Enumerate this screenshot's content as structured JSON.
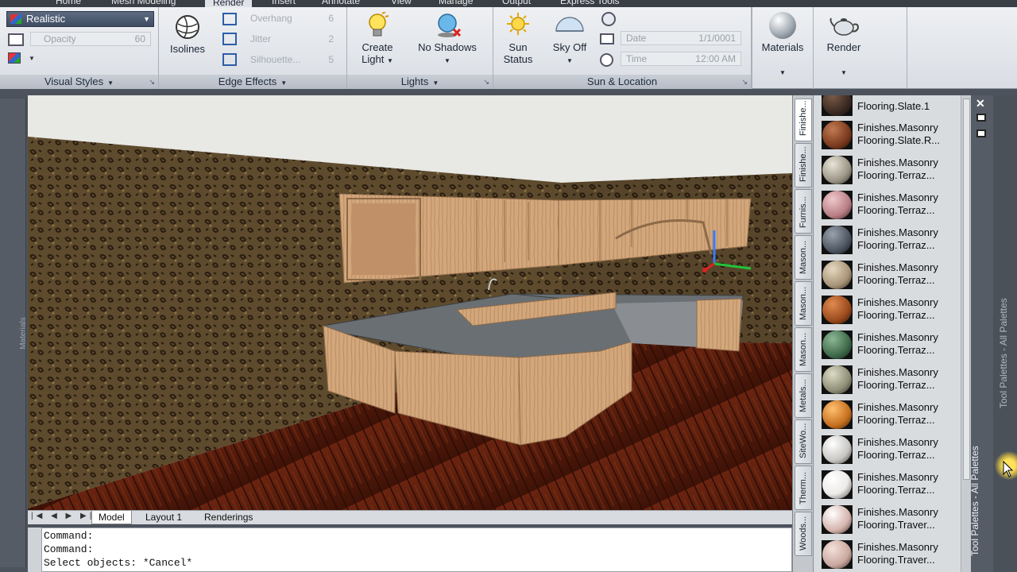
{
  "ribbon_tabs": [
    "Home",
    "Mesh Modeling",
    "Render",
    "Insert",
    "Annotate",
    "View",
    "Manage",
    "Output",
    "Express Tools"
  ],
  "active_tab": "Render",
  "visual_styles": {
    "style": "Realistic",
    "opacity_label": "Opacity",
    "opacity_value": "60",
    "title": "Visual Styles"
  },
  "edge_effects": {
    "isolines": "Isolines",
    "overhang_label": "Overhang",
    "overhang_value": "6",
    "jitter_label": "Jitter",
    "jitter_value": "2",
    "silhouette_label": "Silhouette...",
    "silhouette_value": "5",
    "title": "Edge Effects"
  },
  "lights": {
    "create_light_line1": "Create",
    "create_light_line2": "Light",
    "no_shadows": "No Shadows",
    "title": "Lights"
  },
  "sun_location": {
    "sun_status_line1": "Sun",
    "sun_status_line2": "Status",
    "sky_off": "Sky Off",
    "date_label": "Date",
    "date_value": "1/1/0001",
    "time_label": "Time",
    "time_value": "12:00 AM",
    "title": "Sun & Location"
  },
  "materials_button": "Materials",
  "render_button": "Render",
  "left_strip_label": "Materials",
  "layout_tabs": [
    "Model",
    "Layout 1",
    "Renderings"
  ],
  "command_lines": [
    "Command:",
    "Command:",
    "Select objects: *Cancel*"
  ],
  "palette": {
    "tabs": [
      "Finishe...",
      "Finishe...",
      "Furnis...",
      "Mason...",
      "Mason...",
      "Mason...",
      "Metals...",
      "SiteWo...",
      "Therm...",
      "Woods..."
    ],
    "items": [
      {
        "label": "Flooring.Slate.1",
        "color": "#3a2a22"
      },
      {
        "label": "Finishes.Masonry\nFlooring.Slate.R...",
        "color": "#7a3a1e"
      },
      {
        "label": "Finishes.Masonry\nFlooring.Terraz...",
        "color": "#9b9585"
      },
      {
        "label": "Finishes.Masonry\nFlooring.Terraz...",
        "color": "#b87e84"
      },
      {
        "label": "Finishes.Masonry\nFlooring.Terraz...",
        "color": "#4d5560"
      },
      {
        "label": "Finishes.Masonry\nFlooring.Terraz...",
        "color": "#a89478"
      },
      {
        "label": "Finishes.Masonry\nFlooring.Terraz...",
        "color": "#9a4a1c"
      },
      {
        "label": "Finishes.Masonry\nFlooring.Terraz...",
        "color": "#3f6a4a"
      },
      {
        "label": "Finishes.Masonry\nFlooring.Terraz...",
        "color": "#8f8f78"
      },
      {
        "label": "Finishes.Masonry\nFlooring.Terraz...",
        "color": "#c6701e"
      },
      {
        "label": "Finishes.Masonry\nFlooring.Terraz...",
        "color": "#c7c6c2"
      },
      {
        "label": "Finishes.Masonry\nFlooring.Terraz...",
        "color": "#ecebe8"
      },
      {
        "label": "Finishes.Masonry\nFlooring.Traver...",
        "color": "#d4b4ac"
      },
      {
        "label": "Finishes.Masonry\nFlooring.Traver...",
        "color": "#c9a89e"
      }
    ]
  },
  "palette_title": "Tool Palettes - All Palettes",
  "side_title": "Tool Palettes - All Palettes",
  "colors": {
    "wood_floor": "#5a1d0c",
    "wall": "#5d4a2c",
    "cabinet": "#d3a77c",
    "countertop": "#5f6468"
  }
}
